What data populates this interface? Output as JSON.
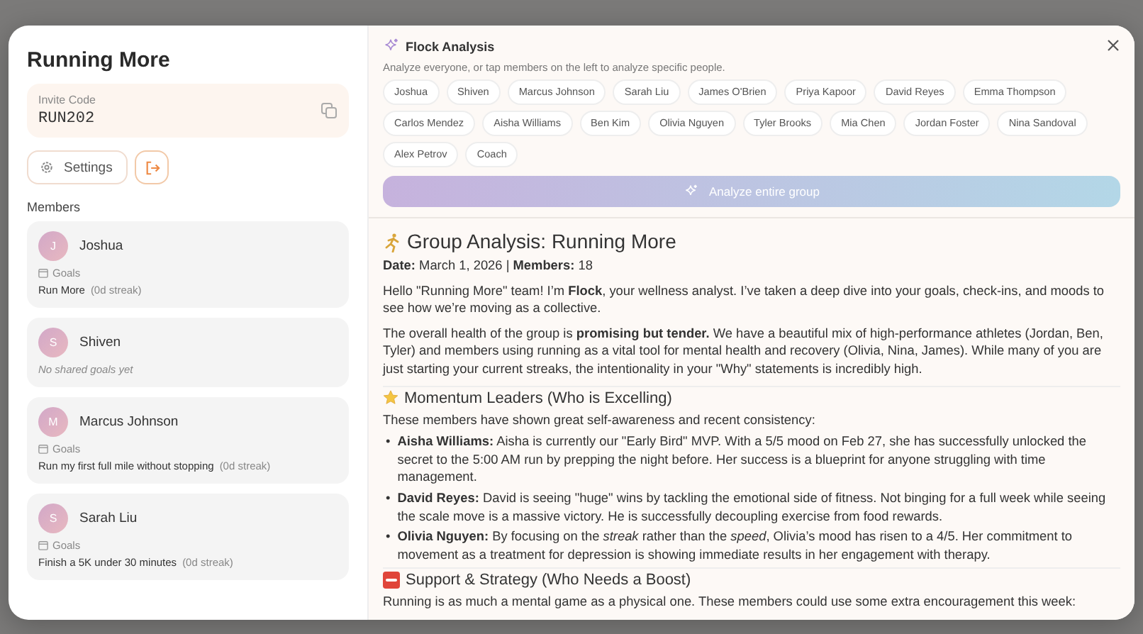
{
  "group": {
    "name": "Running More",
    "invite_label": "Invite Code",
    "invite_code": "RUN202",
    "settings_label": "Settings",
    "members_heading": "Members",
    "members": [
      {
        "initial": "J",
        "name": "Joshua",
        "goals_label": "Goals",
        "goals": [
          {
            "text": "Run More",
            "streak": "(0d streak)"
          }
        ]
      },
      {
        "initial": "S",
        "name": "Shiven",
        "empty_text": "No shared goals yet"
      },
      {
        "initial": "M",
        "name": "Marcus Johnson",
        "goals_label": "Goals",
        "goals": [
          {
            "text": "Run my first full mile without stopping",
            "streak": "(0d streak)"
          }
        ]
      },
      {
        "initial": "S",
        "name": "Sarah Liu",
        "goals_label": "Goals",
        "goals": [
          {
            "text": "Finish a 5K under 30 minutes",
            "streak": "(0d streak)"
          }
        ]
      }
    ]
  },
  "analysis": {
    "title": "Flock Analysis",
    "subtitle": "Analyze everyone, or tap members on the left to analyze specific people.",
    "chips": [
      {
        "label": "Joshua",
        "selected": false
      },
      {
        "label": "Shiven",
        "selected": false
      },
      {
        "label": "Marcus Johnson",
        "selected": false
      },
      {
        "label": "Sarah Liu",
        "selected": false
      },
      {
        "label": "James O'Brien",
        "selected": false
      },
      {
        "label": "Priya Kapoor",
        "selected": false
      },
      {
        "label": "David Reyes",
        "selected": false
      },
      {
        "label": "Emma Thompson",
        "selected": false
      },
      {
        "label": "Carlos Mendez",
        "selected": false
      },
      {
        "label": "Aisha Williams",
        "selected": false
      },
      {
        "label": "Ben Kim",
        "selected": false
      },
      {
        "label": "Olivia Nguyen",
        "selected": false
      },
      {
        "label": "Tyler Brooks",
        "selected": false
      },
      {
        "label": "Mia Chen",
        "selected": false
      },
      {
        "label": "Jordan Foster",
        "selected": false
      },
      {
        "label": "Nina Sandoval",
        "selected": false
      },
      {
        "label": "Alex Petrov",
        "selected": false
      },
      {
        "label": "Coach",
        "selected": false
      }
    ],
    "analyze_button": "Analyze entire group",
    "report": {
      "heading": "Group Analysis: Running More",
      "meta": "**Date:** March 1, 2026 | **Members:** 18",
      "paragraphs": [
        "Hello \"Running More\" team! I’m **Flock**, your wellness analyst. I’ve taken a deep dive into your goals, check-ins, and moods to see how we’re moving as a collective.",
        "The overall health of the group is **promising but tender.** We have a beautiful mix of high-performance athletes (Jordan, Ben, Tyler) and members using running as a vital tool for mental health and recovery (Olivia, Nina, James). While many of you are just starting your current streaks, the intentionality in your \"Why\" statements is incredibly high."
      ],
      "sections": [
        {
          "heading": "Momentum Leaders (Who is Excelling)",
          "intro": "These members have shown great self-awareness and recent consistency:",
          "bullets": [
            {
              "marker": "•",
              "text": "**Aisha Williams:** Aisha is currently our \"Early Bird\" MVP. With a 5/5 mood on Feb 27, she has successfully unlocked the secret to the 5:00 AM run by prepping the night before. Her success is a blueprint for anyone struggling with time management."
            },
            {
              "marker": "•",
              "text": "**David Reyes:** David is seeing \"huge\" wins by tackling the emotional side of fitness. Not binging for a full week while seeing the scale move is a massive victory. He is successfully decoupling exercise from food rewards."
            },
            {
              "marker": "•",
              "text": "**Olivia Nguyen:** By focusing on the *streak* rather than the *speed*, Olivia’s mood has risen to a 4/5. Her commitment to movement as a treatment for depression is showing immediate results in her engagement with therapy."
            }
          ]
        },
        {
          "heading": "Support & Strategy (Who Needs a Boost)",
          "intro": "Running is as much a mental game as a physical one. These members could use some extra encouragement this week:"
        }
      ]
    }
  }
}
